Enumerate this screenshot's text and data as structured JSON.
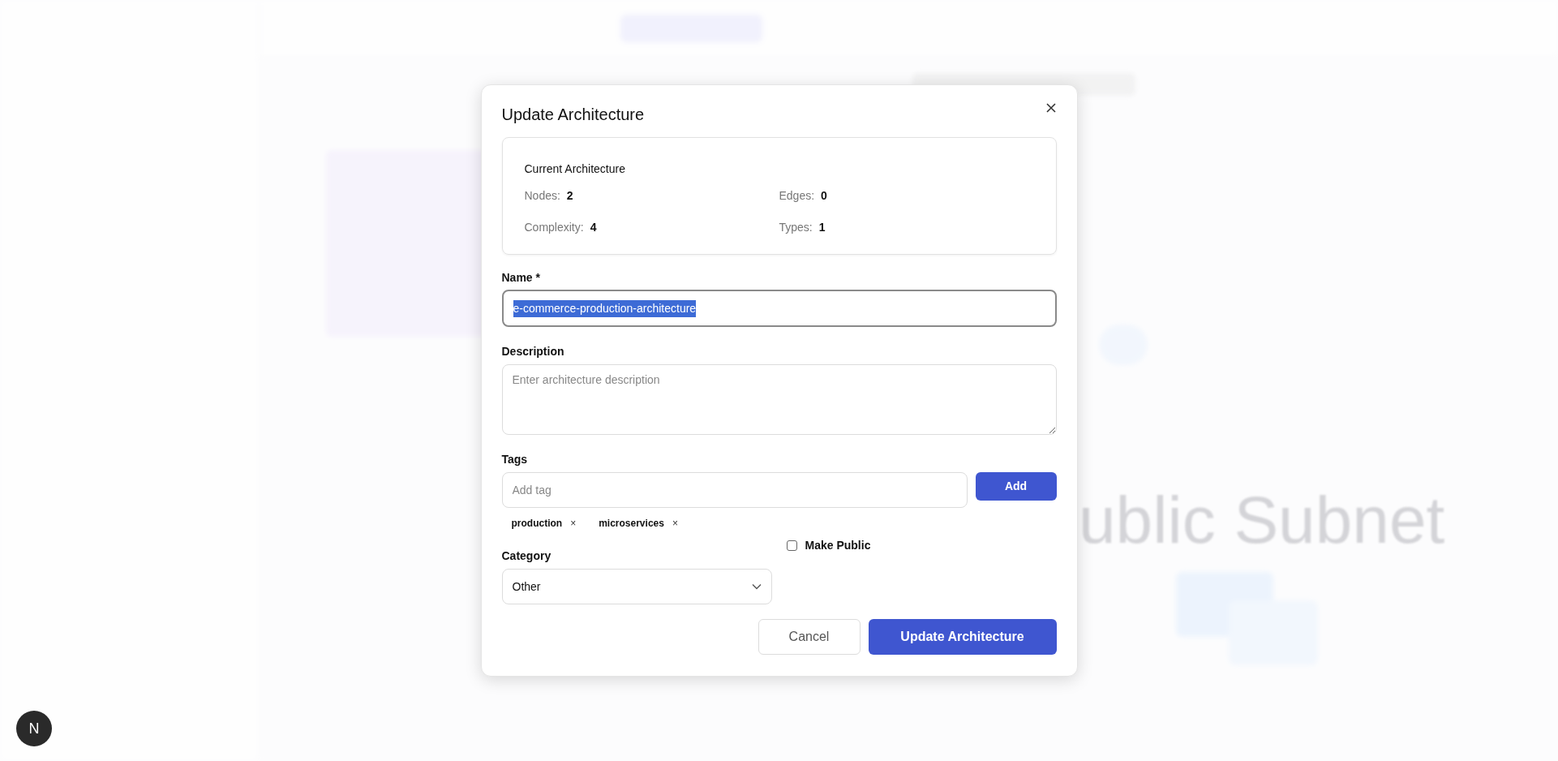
{
  "background": {
    "canvas_label": "ublic Subnet",
    "badge": "N"
  },
  "dialog": {
    "title": "Update Architecture",
    "summary": {
      "title": "Current Architecture",
      "stats": [
        {
          "label": "Nodes:",
          "value": "2"
        },
        {
          "label": "Edges:",
          "value": "0"
        },
        {
          "label": "Complexity:",
          "value": "4"
        },
        {
          "label": "Types:",
          "value": "1"
        }
      ]
    },
    "name": {
      "label": "Name *",
      "value": "e-commerce-production-architecture",
      "selected": true
    },
    "description": {
      "label": "Description",
      "placeholder": "Enter architecture description"
    },
    "tags": {
      "label": "Tags",
      "placeholder": "Add tag",
      "add_button": "Add",
      "items": [
        {
          "label": "production",
          "remove": "×"
        },
        {
          "label": "microservices",
          "remove": "×"
        }
      ]
    },
    "category": {
      "label": "Category",
      "value": "Other"
    },
    "make_public": {
      "label": "Make Public",
      "checked": false
    },
    "buttons": {
      "cancel": "Cancel",
      "submit": "Update Architecture"
    }
  }
}
